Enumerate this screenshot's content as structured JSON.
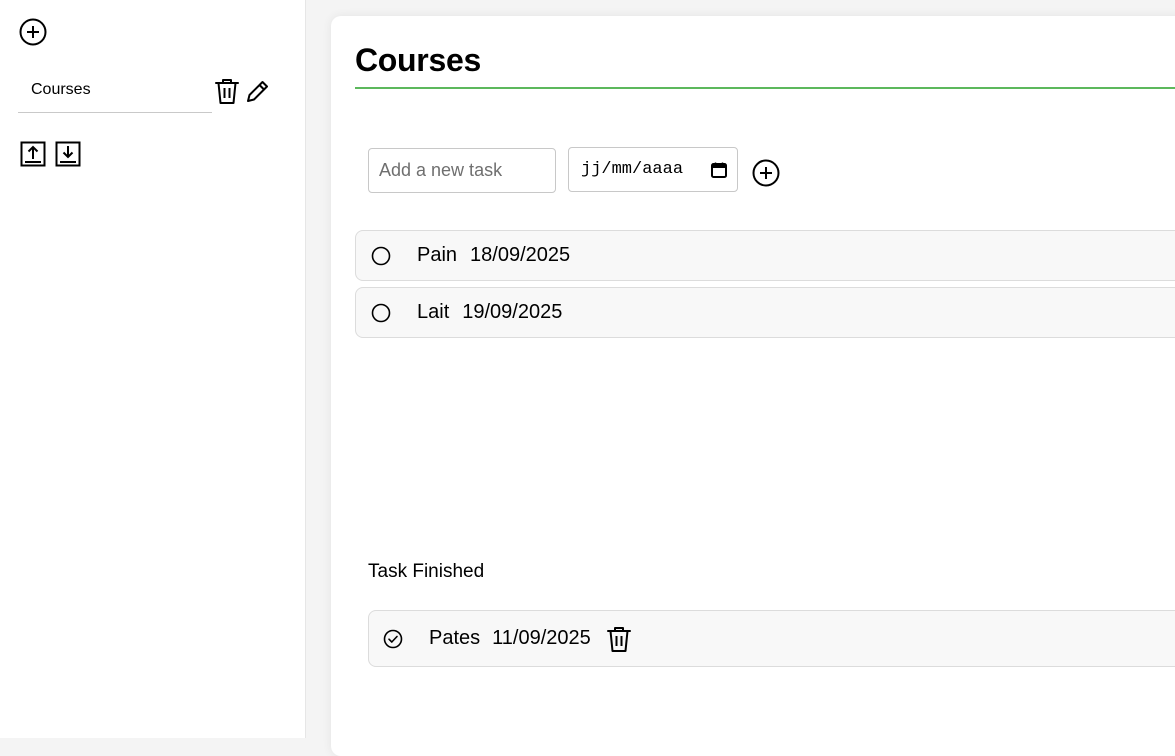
{
  "sidebar": {
    "lists": [
      {
        "label": "Courses"
      }
    ],
    "icons": {
      "add_list": "plus-circle-icon",
      "delete_list": "trash-icon",
      "edit_list": "pencil-icon",
      "import": "upload-icon",
      "export": "download-icon"
    }
  },
  "main": {
    "title": "Courses",
    "accent_color": "#5cb85c",
    "new_task": {
      "placeholder": "Add a new task",
      "date_placeholder": "jj/mm/aaaa"
    },
    "tasks": [
      {
        "name": "Pain",
        "date": "18/09/2025"
      },
      {
        "name": "Lait",
        "date": "19/09/2025"
      }
    ],
    "finished_heading": "Task Finished",
    "finished_tasks": [
      {
        "name": "Pates",
        "date": "11/09/2025"
      }
    ]
  }
}
